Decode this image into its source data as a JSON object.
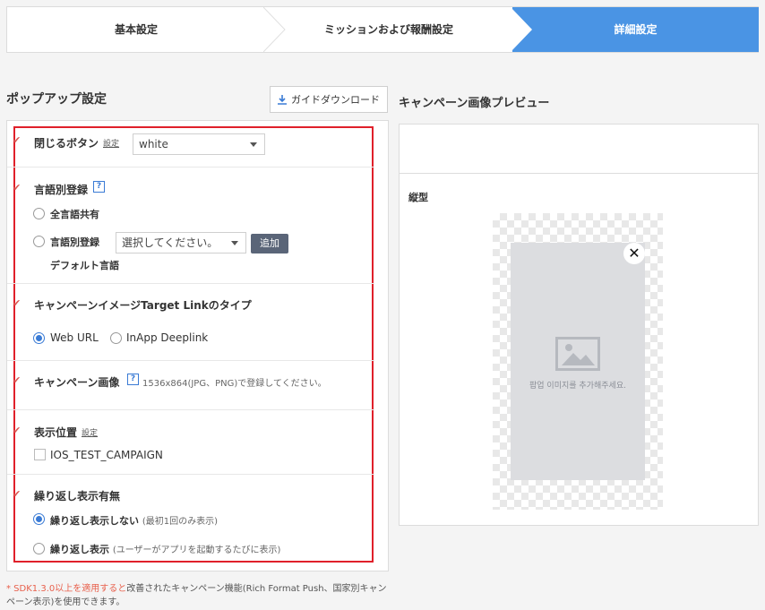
{
  "steps": [
    "基本設定",
    "ミッションおよび報酬設定",
    "詳細設定"
  ],
  "popup": {
    "title": "ポップアップ設定",
    "guide_button": "ガイドダウンロード",
    "close_button": {
      "label": "閉じるボタン",
      "link": "設定",
      "value": "white"
    },
    "language": {
      "label": "言語別登録",
      "help": "?",
      "option_common": "全言語共有",
      "option_by_language": "言語別登録",
      "select_placeholder": "選択してください。",
      "add_button": "追加",
      "default_language": "デフォルト言語"
    },
    "target_link": {
      "label": "キャンペーンイメージTarget Linkのタイプ",
      "option_web": "Web URL",
      "option_inapp": "InApp Deeplink"
    },
    "campaign_image": {
      "label": "キャンペーン画像",
      "help": "?",
      "note": "1536x864(JPG、PNG)で登録してください。"
    },
    "display_position": {
      "label": "表示位置",
      "link": "設定",
      "checkbox_label": "IOS_TEST_CAMPAIGN"
    },
    "repeat": {
      "label": "繰り返し表示有無",
      "option_no": "繰り返し表示しない",
      "option_no_note": "(最初1回のみ表示)",
      "option_yes": "繰り返し表示",
      "option_yes_note": "(ユーザーがアプリを起動するたびに表示)"
    },
    "footnote_red": "* SDK1.3.0以上を適用すると",
    "footnote_rest": "改善されたキャンペーン機能(Rich Format Push、国家別キャンペーン表示)を使用できます。"
  },
  "preview": {
    "title": "キャンペーン画像プレビュー",
    "orientation": "縦型",
    "placeholder": "팝업 이미지를 추가해주세요.",
    "close_symbol": "✕"
  },
  "colors": {
    "accent": "#4a94e4",
    "highlight": "#e0202a"
  }
}
